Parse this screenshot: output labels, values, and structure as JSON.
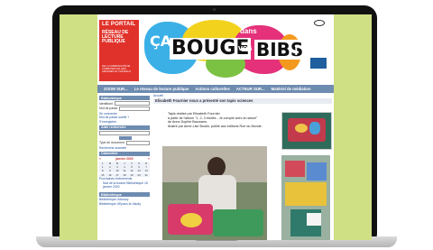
{
  "site": {
    "logo_line1": "LE PORTAIL",
    "logo_line2": "RÉSEAU DE LECTURE PUBLIQUE",
    "logo_line3": "DE LA COMMUNAUTÉ DE COMMUNES VAL DES AMOGNES ET CHÂTEAUX",
    "banner": {
      "ca": "ÇA",
      "bouge": "BOUGE",
      "dans": "dans",
      "vos": "vos",
      "bibs": "BIBS",
      "excl": "!"
    }
  },
  "nav": {
    "items": [
      "ZOOM SUR...",
      "Le réseau de lecture publique",
      "Actions culturelles",
      "ACTEUR SUR...",
      "Matériel de médiation"
    ]
  },
  "sidebar": {
    "account_title": "Bibliothèque",
    "login_label": "Identifiant",
    "password_label": "Mot de passe",
    "links": [
      "Se connecter",
      "Mot de passe oublié ?",
      "S'enregistrer"
    ],
    "search_title": "Aide recherche",
    "search_type": "Type de document",
    "advanced": "Recherche avancée",
    "calendar_title": "Calendrier",
    "calendar_month": "janvier 2020",
    "days": [
      "L",
      "M",
      "M",
      "J",
      "V",
      "S",
      "D",
      "1",
      "2",
      "3",
      "4",
      "5",
      "6",
      "7",
      "8",
      "9",
      "10",
      "11",
      "12",
      "13",
      "14",
      "15",
      "16",
      "17",
      "18",
      "19",
      "20",
      "21"
    ],
    "next_events": "Prochaines événements",
    "event_text": "Nuit de la lecture Bibliothèque 18 janvier 2020",
    "libraries_title": "Bibliothèque",
    "libraries": [
      "Bibliothèque d'Amazy",
      "Bibliothèque d'Epaux-le-Vaudy"
    ]
  },
  "main": {
    "breadcrumb": "Accueil",
    "title": "Elisabeth Fournier nous a présenté son tapis sciences",
    "text": [
      "Tapis réalisé par Elisabeth Fournier",
      "à partir de l'album \"1, 2, 3 étoiles - Je compte avec la nature\"",
      "de Anne-Sophie Baumann,",
      "illustré par Anne-Lise Boutin, publié aux éditions Rue du Monde."
    ]
  }
}
